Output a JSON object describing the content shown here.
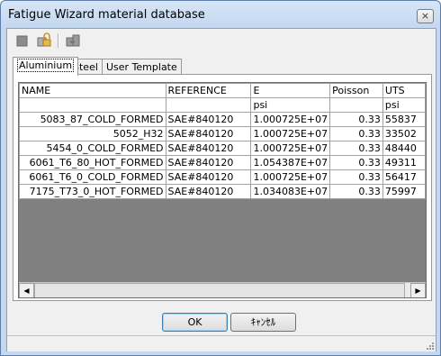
{
  "window": {
    "title": "Fatigue Wizard material database",
    "close_glyph": "×"
  },
  "toolbar": {
    "icons": [
      "new-icon",
      "lock-icon",
      "copy-icon"
    ]
  },
  "tabs": [
    {
      "label": "Aluminium",
      "active": true
    },
    {
      "label": "Steel",
      "active": false
    },
    {
      "label": "User Template",
      "active": false
    }
  ],
  "grid": {
    "columns": [
      "NAME",
      "REFERENCE",
      "E",
      "Poisson",
      "UTS"
    ],
    "units": [
      "",
      "",
      "psi",
      "",
      "psi"
    ],
    "rows": [
      [
        "5083_87_COLD_FORMED",
        "SAE#840120",
        "1.000725E+07",
        "0.33",
        "55837"
      ],
      [
        "5052_H32",
        "SAE#840120",
        "1.000725E+07",
        "0.33",
        "33502"
      ],
      [
        "5454_0_COLD_FORMED",
        "SAE#840120",
        "1.000725E+07",
        "0.33",
        "48440"
      ],
      [
        "6061_T6_80_HOT_FORMED",
        "SAE#840120",
        "1.054387E+07",
        "0.33",
        "49311"
      ],
      [
        "6061_T6_0_COLD_FORMED",
        "SAE#840120",
        "1.000725E+07",
        "0.33",
        "56417"
      ],
      [
        "7175_T73_0_HOT_FORMED",
        "SAE#840120",
        "1.034083E+07",
        "0.33",
        "75997"
      ]
    ]
  },
  "scrollbar": {
    "left_glyph": "◀",
    "right_glyph": "▶"
  },
  "buttons": {
    "ok": "OK",
    "cancel": "ｷｬﾝｾﾙ"
  },
  "colors": {
    "title_bg": "#c3d7ef",
    "grid_empty": "#808080",
    "dialog_bg": "#f0f0f0"
  }
}
